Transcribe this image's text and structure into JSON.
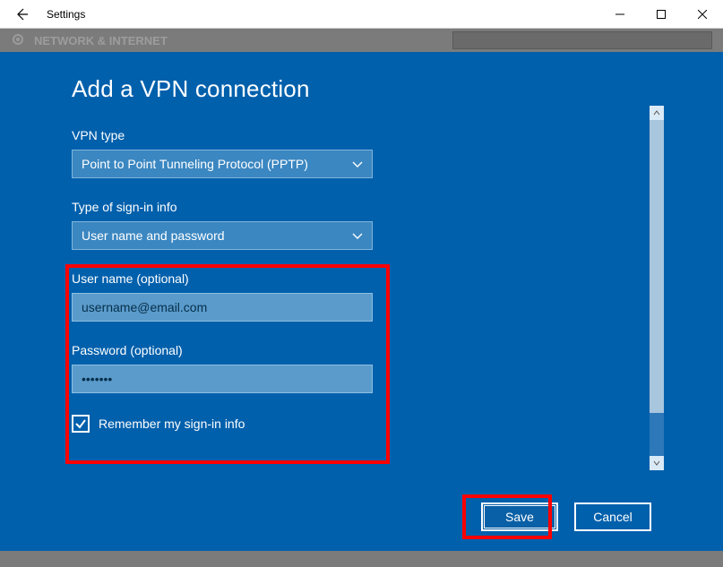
{
  "window": {
    "title": "Settings"
  },
  "background": {
    "heading": "NETWORK & INTERNET"
  },
  "modal": {
    "heading": "Add a VPN connection",
    "fields": {
      "vpn_type": {
        "label": "VPN type",
        "value": "Point to Point Tunneling Protocol (PPTP)"
      },
      "signin_type": {
        "label": "Type of sign-in info",
        "value": "User name and password"
      },
      "username": {
        "label": "User name (optional)",
        "value": "username@email.com"
      },
      "password": {
        "label": "Password (optional)",
        "value": "•••••••"
      },
      "remember": {
        "label": "Remember my sign-in info",
        "checked": true
      }
    },
    "buttons": {
      "save": "Save",
      "cancel": "Cancel"
    }
  }
}
